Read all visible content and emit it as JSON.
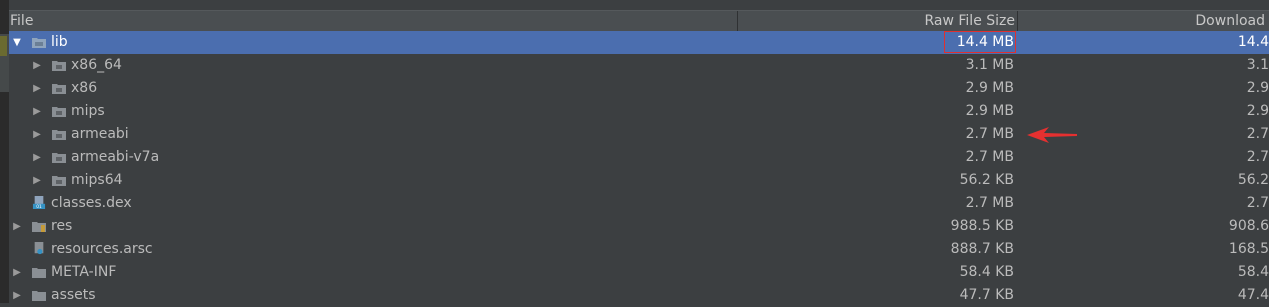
{
  "header": {
    "file": "File",
    "raw_size": "Raw File Size",
    "download_size": "Download"
  },
  "rows": [
    {
      "name": "lib",
      "raw": "14.4 MB",
      "dl": "14.4"
    },
    {
      "name": "x86_64",
      "raw": "3.1 MB",
      "dl": "3.1"
    },
    {
      "name": "x86",
      "raw": "2.9 MB",
      "dl": "2.9"
    },
    {
      "name": "mips",
      "raw": "2.9 MB",
      "dl": "2.9"
    },
    {
      "name": "armeabi",
      "raw": "2.7 MB",
      "dl": "2.7"
    },
    {
      "name": "armeabi-v7a",
      "raw": "2.7 MB",
      "dl": "2.7"
    },
    {
      "name": "mips64",
      "raw": "56.2 KB",
      "dl": "56.2"
    },
    {
      "name": "classes.dex",
      "raw": "2.7 MB",
      "dl": "2.7"
    },
    {
      "name": "res",
      "raw": "988.5 KB",
      "dl": "908.6"
    },
    {
      "name": "resources.arsc",
      "raw": "888.7 KB",
      "dl": "168.5"
    },
    {
      "name": "META-INF",
      "raw": "58.4 KB",
      "dl": "58.4"
    },
    {
      "name": "assets",
      "raw": "47.7 KB",
      "dl": "47.4"
    }
  ],
  "colors": {
    "selection": "#4b6eaf",
    "annotation": "#e03030",
    "background": "#3c3f41"
  },
  "icons": {
    "folder": "folder-icon",
    "dex": "dex-file-icon",
    "arsc": "arsc-file-icon",
    "expand": "expand-arrow-icon",
    "collapse": "collapse-arrow-icon"
  }
}
